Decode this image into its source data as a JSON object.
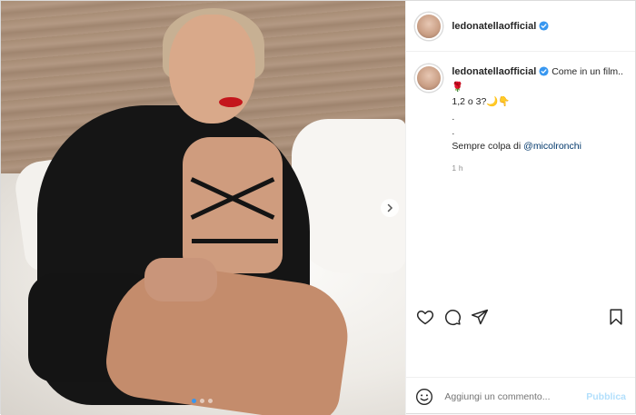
{
  "post": {
    "username": "ledonatellaofficial",
    "verified": true,
    "caption": {
      "text": "Come in un film..",
      "lines": [
        "🌹",
        "1,2 o 3?🌙👇",
        ".",
        ".",
        "Sempre colpa di "
      ],
      "mention": "@micolronchi"
    },
    "time": "1 h",
    "carousel": {
      "current": 1,
      "total": 3
    }
  },
  "comment_box": {
    "placeholder": "Aggiungi un commento...",
    "publish_label": "Pubblica"
  },
  "icons": {
    "like": "heart-icon",
    "comment": "comment-icon",
    "share": "share-icon",
    "save": "bookmark-icon",
    "emoji": "emoji-icon",
    "next": "chevron-right-icon",
    "verified": "verified-badge-icon"
  },
  "colors": {
    "verified": "#3897f0",
    "link": "#00376b",
    "publish_disabled": "#b2dffc"
  }
}
